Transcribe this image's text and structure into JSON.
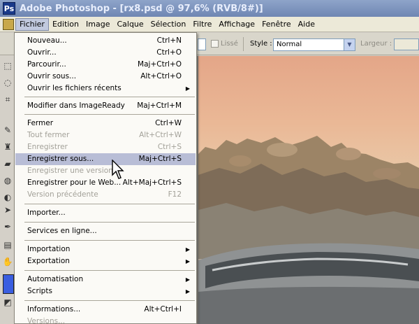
{
  "window": {
    "title": "Adobe Photoshop - [rx8.psd @ 97,6% (RVB/8#)]",
    "icon": "photoshop-app-icon"
  },
  "menubar": {
    "items": [
      {
        "label": "Fichier",
        "active": true
      },
      {
        "label": "Edition"
      },
      {
        "label": "Image"
      },
      {
        "label": "Calque"
      },
      {
        "label": "Sélection"
      },
      {
        "label": "Filtre"
      },
      {
        "label": "Affichage"
      },
      {
        "label": "Fenêtre"
      },
      {
        "label": "Aide"
      }
    ]
  },
  "options": {
    "smooth_label": "Lissé",
    "style_label": "Style :",
    "style_value": "Normal",
    "width_label": "Largeur :"
  },
  "file_menu": {
    "rows": [
      {
        "label": "Nouveau...",
        "shortcut": "Ctrl+N"
      },
      {
        "label": "Ouvrir...",
        "shortcut": "Ctrl+O"
      },
      {
        "label": "Parcourir...",
        "shortcut": "Maj+Ctrl+O"
      },
      {
        "label": "Ouvrir sous...",
        "shortcut": "Alt+Ctrl+O"
      },
      {
        "label": "Ouvrir les fichiers récents",
        "submenu": true
      },
      {
        "label": "Modifier dans ImageReady",
        "shortcut": "Maj+Ctrl+M"
      },
      {
        "label": "Fermer",
        "shortcut": "Ctrl+W"
      },
      {
        "label": "Tout fermer",
        "shortcut": "Alt+Ctrl+W",
        "disabled": true
      },
      {
        "label": "Enregistrer",
        "shortcut": "Ctrl+S",
        "disabled": true
      },
      {
        "label": "Enregistrer sous...",
        "shortcut": "Maj+Ctrl+S",
        "highlighted": true
      },
      {
        "label": "Enregistrer une version...",
        "disabled": true
      },
      {
        "label": "Enregistrer pour le Web...",
        "shortcut": "Alt+Maj+Ctrl+S"
      },
      {
        "label": "Version précédente",
        "shortcut": "F12",
        "disabled": true
      },
      {
        "label": "Importer..."
      },
      {
        "label": "Services en ligne..."
      },
      {
        "label": "Importation",
        "submenu": true
      },
      {
        "label": "Exportation",
        "submenu": true
      },
      {
        "label": "Automatisation",
        "submenu": true
      },
      {
        "label": "Scripts",
        "submenu": true
      },
      {
        "label": "Informations...",
        "shortcut": "Alt+Ctrl+I"
      },
      {
        "label": "Versions...",
        "disabled": true
      }
    ]
  },
  "colors": {
    "foreground": "#3a5ee0",
    "menu_highlight": "#b8bdd6"
  }
}
